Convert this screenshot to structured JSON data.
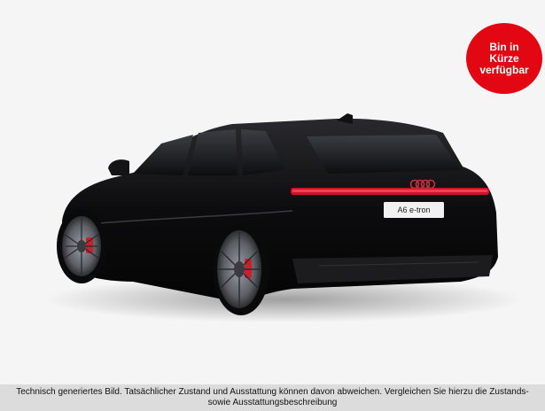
{
  "badge": {
    "text": "Bin in\nKürze\nverfügbar",
    "color": "#e30613"
  },
  "car": {
    "plate_text": "A6 e-tron",
    "body_color": "#0e0e10",
    "light_color": "#d0112b"
  },
  "disclaimer": {
    "text": "Technisch generiertes Bild. Tatsächlicher Zustand und Ausstattung können davon abweichen. Vergleichen Sie hierzu die Zustands- sowie Ausstattungsbeschreibung"
  }
}
